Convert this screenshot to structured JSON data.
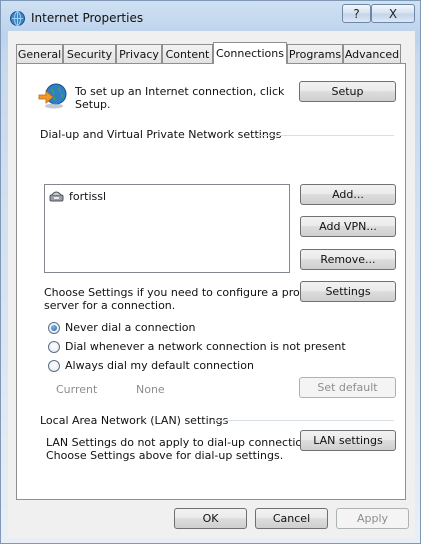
{
  "window": {
    "title": "Internet Properties",
    "help_glyph": "?",
    "close_glyph": "X"
  },
  "tabs": [
    {
      "label": "General",
      "active": false
    },
    {
      "label": "Security",
      "active": false
    },
    {
      "label": "Privacy",
      "active": false
    },
    {
      "label": "Content",
      "active": false
    },
    {
      "label": "Connections",
      "active": true
    },
    {
      "label": "Programs",
      "active": false
    },
    {
      "label": "Advanced",
      "active": false
    }
  ],
  "setup": {
    "description_line1": "To set up an Internet connection, click",
    "description_line2": "Setup.",
    "button": "Setup"
  },
  "dialup": {
    "section_title": "Dial-up and Virtual Private Network settings",
    "connections": [
      "fortissl"
    ],
    "add_button": "Add...",
    "add_vpn_button": "Add VPN...",
    "remove_button": "Remove...",
    "settings_prompt_line1": "Choose Settings if you need to configure a proxy",
    "settings_prompt_line2": "server for a connection.",
    "settings_button": "Settings",
    "options": [
      {
        "label": "Never dial a connection",
        "checked": true
      },
      {
        "label": "Dial whenever a network connection is not present",
        "checked": false
      },
      {
        "label": "Always dial my default connection",
        "checked": false
      }
    ],
    "current_label": "Current",
    "current_value": "None",
    "set_default_button": "Set default"
  },
  "lan": {
    "section_title": "Local Area Network (LAN) settings",
    "note_line1": "LAN Settings do not apply to dial-up connections.",
    "note_line2": "Choose Settings above for dial-up settings.",
    "button": "LAN settings"
  },
  "footer": {
    "ok": "OK",
    "cancel": "Cancel",
    "apply": "Apply"
  },
  "icons": [
    "internet-properties-icon",
    "globe-setup-icon",
    "dialup-connection-icon"
  ],
  "colors": {
    "titlebar": "#bcd3ec",
    "client": "#f0f0f0",
    "panel": "#ffffff",
    "radio_accent": "#1f5fa8"
  }
}
